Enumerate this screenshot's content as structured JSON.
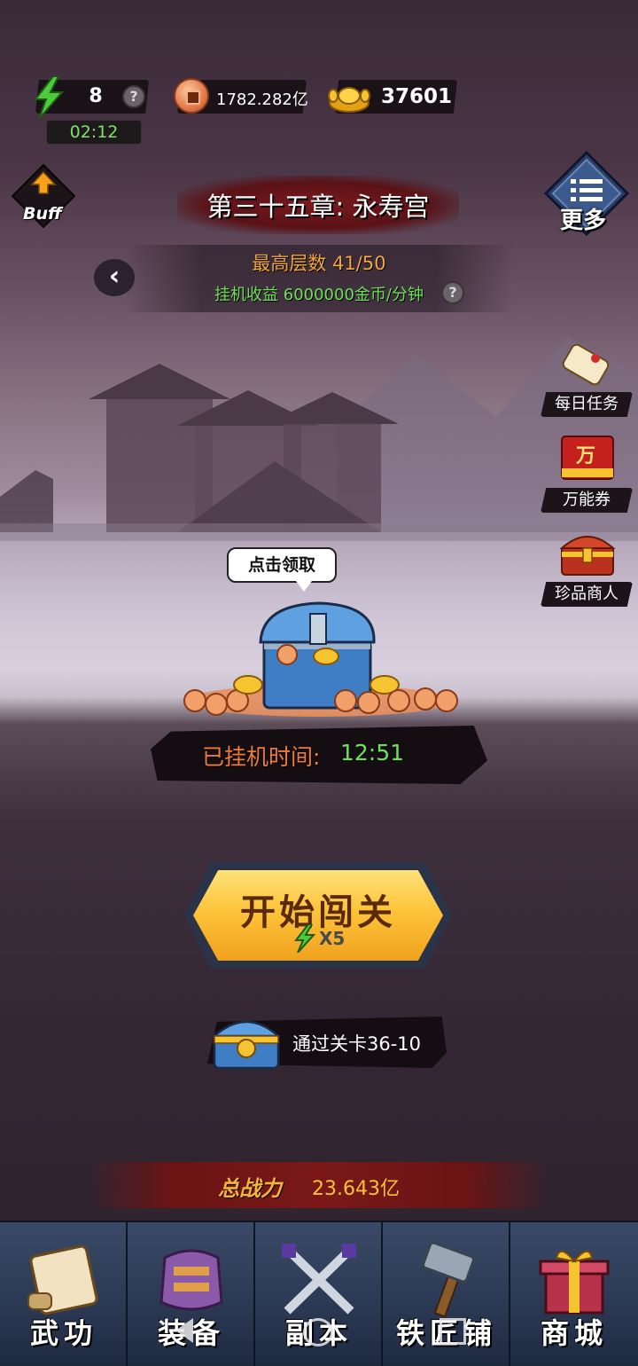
{
  "resources": {
    "energy": "8",
    "energy_help": "?",
    "energy_timer": "02:12",
    "copper": "1782.282亿",
    "gold": "37601"
  },
  "buff": {
    "label": "Buff"
  },
  "more": {
    "label": "更多"
  },
  "chapter": {
    "title": "第三十五章: 永寿宫",
    "max_floor": "最高层数 41/50",
    "idle_income": "挂机收益 6000000金币/分钟",
    "income_help": "?",
    "back": "‹"
  },
  "side_menu": [
    {
      "label": "每日任务",
      "icon": "scroll-icon"
    },
    {
      "label": "万能券",
      "icon": "voucher-icon",
      "badge": "万"
    },
    {
      "label": "珍品商人",
      "icon": "treasure-chest-icon"
    }
  ],
  "treasure": {
    "bubble": "点击领取",
    "idle_label": "已挂机时间:",
    "idle_time": "12:51"
  },
  "start": {
    "label": "开始闯关",
    "cost": "X5"
  },
  "reward": {
    "label": "通过关卡36-10"
  },
  "power": {
    "label": "总战力",
    "value": "23.643亿"
  },
  "nav": [
    {
      "label": "武功",
      "icon": "martial-scroll-icon"
    },
    {
      "label": "装备",
      "icon": "armor-icon"
    },
    {
      "label": "副本",
      "icon": "crossed-swords-icon"
    },
    {
      "label": "铁匠铺",
      "icon": "hammer-icon"
    },
    {
      "label": "商城",
      "icon": "gift-box-icon"
    }
  ],
  "colors": {
    "accent_gold": "#fdc33a",
    "green_text": "#6fe05a",
    "orange_text": "#f3a63a",
    "nav_bg": "#2a3852"
  }
}
